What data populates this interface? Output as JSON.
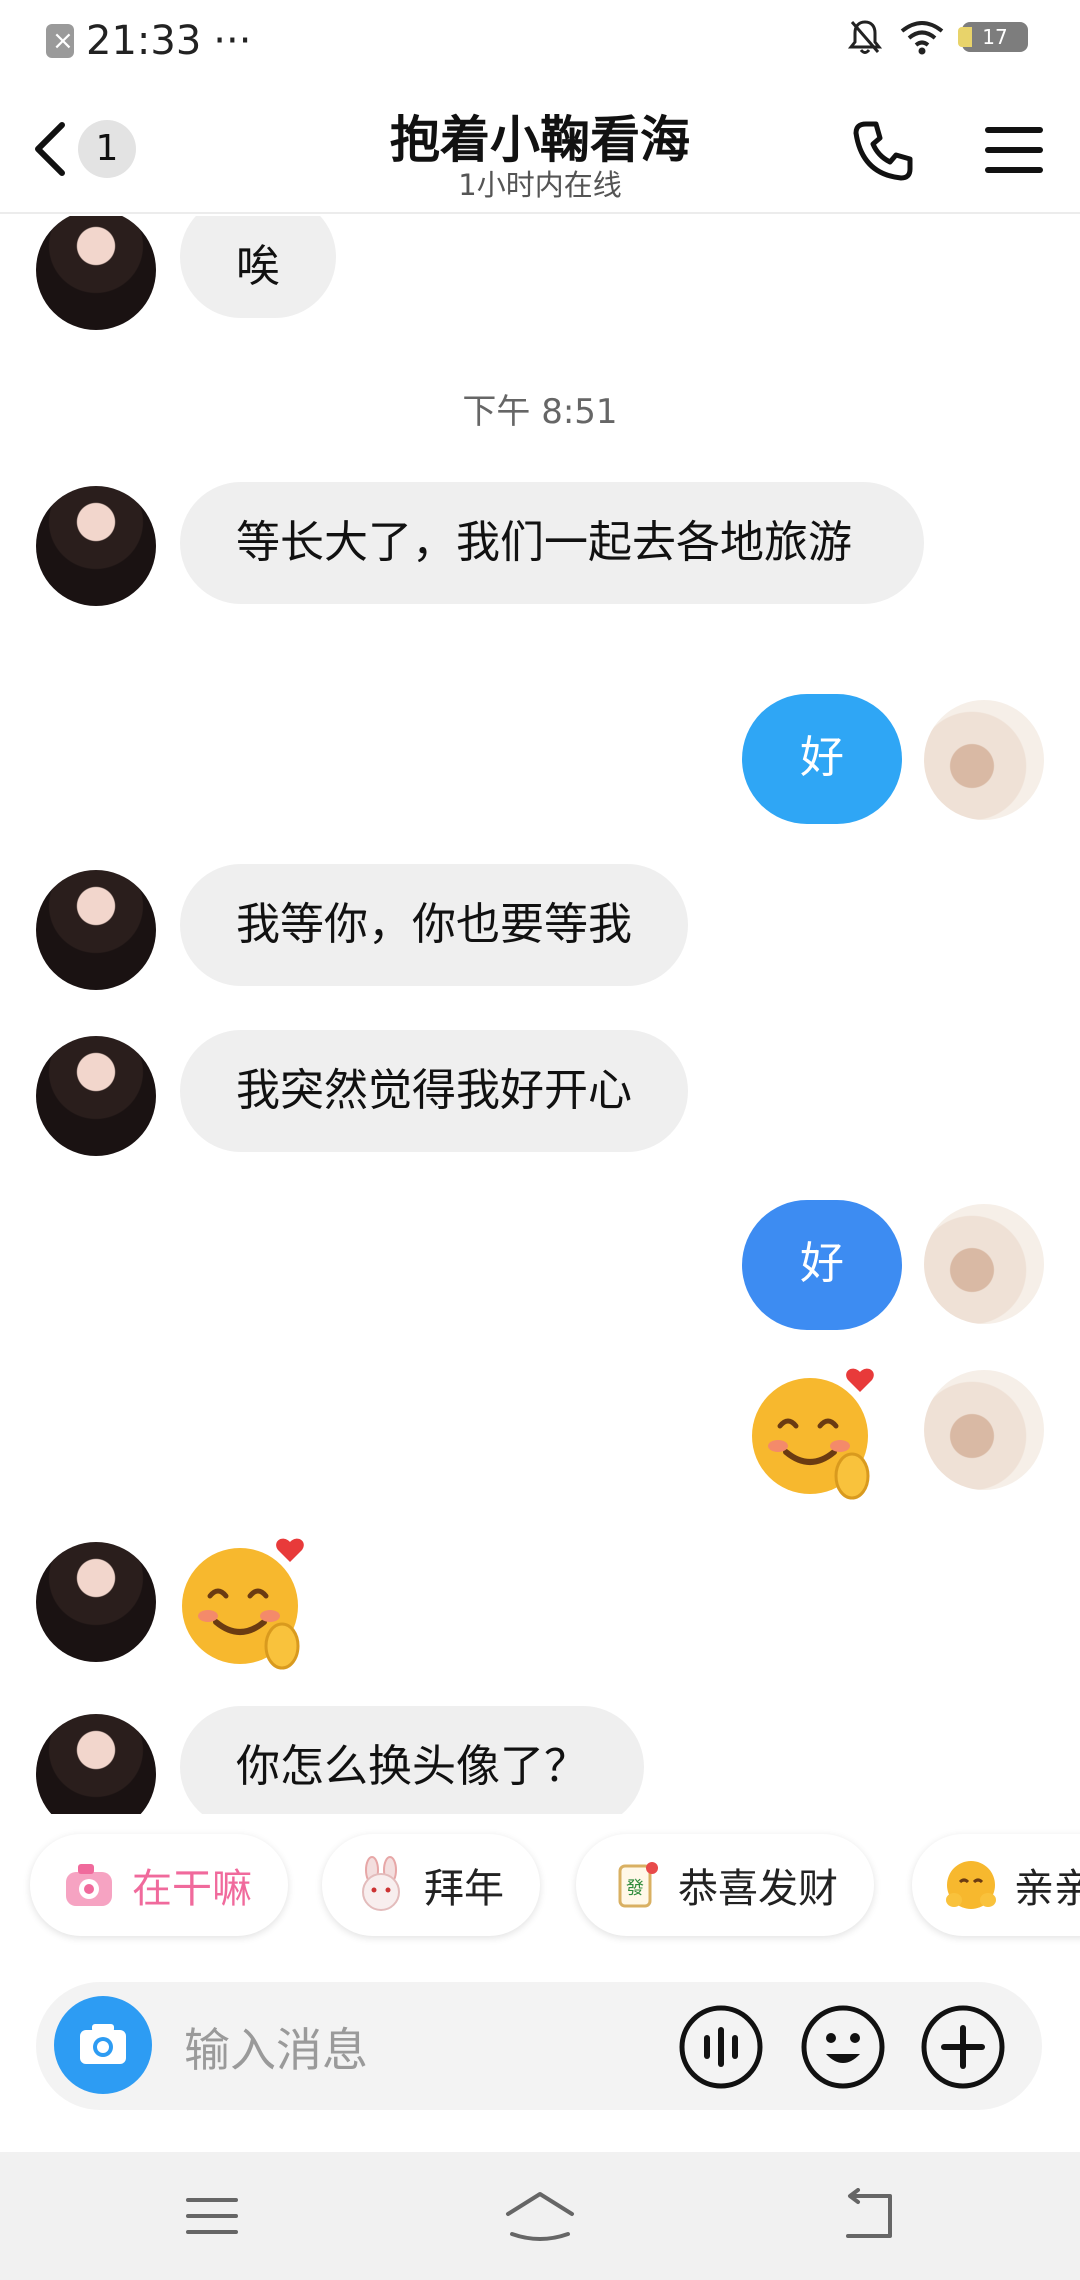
{
  "status_bar": {
    "time": "21:33",
    "more": "···",
    "battery_level": "17"
  },
  "header": {
    "back_count": "1",
    "title": "抱着小鞠看海",
    "subtitle": "1小时内在线"
  },
  "chat": {
    "timestamp": "下午 8:51",
    "messages": [
      {
        "from": "them",
        "text": "唉"
      },
      {
        "from": "them",
        "text": "等长大了，我们一起去各地旅游"
      },
      {
        "from": "me",
        "text": "好"
      },
      {
        "from": "them",
        "text": "我等你，你也要等我"
      },
      {
        "from": "them",
        "text": "我突然觉得我好开心"
      },
      {
        "from": "me",
        "text": "好"
      },
      {
        "from": "me",
        "type": "emoji",
        "emoji": "smiling-face-with-heart-gesture"
      },
      {
        "from": "them",
        "type": "emoji",
        "emoji": "smiling-face-with-heart-gesture"
      },
      {
        "from": "them",
        "text": "你怎么换头像了？"
      }
    ]
  },
  "quick_phrases": [
    {
      "label": "在干嘛",
      "icon": "camera-sticker-icon",
      "color": "#f06a9c"
    },
    {
      "label": "拜年",
      "icon": "rabbit-icon",
      "color": "#222222"
    },
    {
      "label": "恭喜发财",
      "icon": "mahjong-icon",
      "color": "#222222"
    },
    {
      "label": "亲亲",
      "icon": "hug-emoji-icon",
      "color": "#222222"
    }
  ],
  "input": {
    "placeholder": "输入消息"
  },
  "colors": {
    "my_bubble_1": "#2fa6f5",
    "my_bubble_2": "#3d8cf2",
    "their_bubble": "#efefef",
    "accent": "#2d9cf3"
  }
}
